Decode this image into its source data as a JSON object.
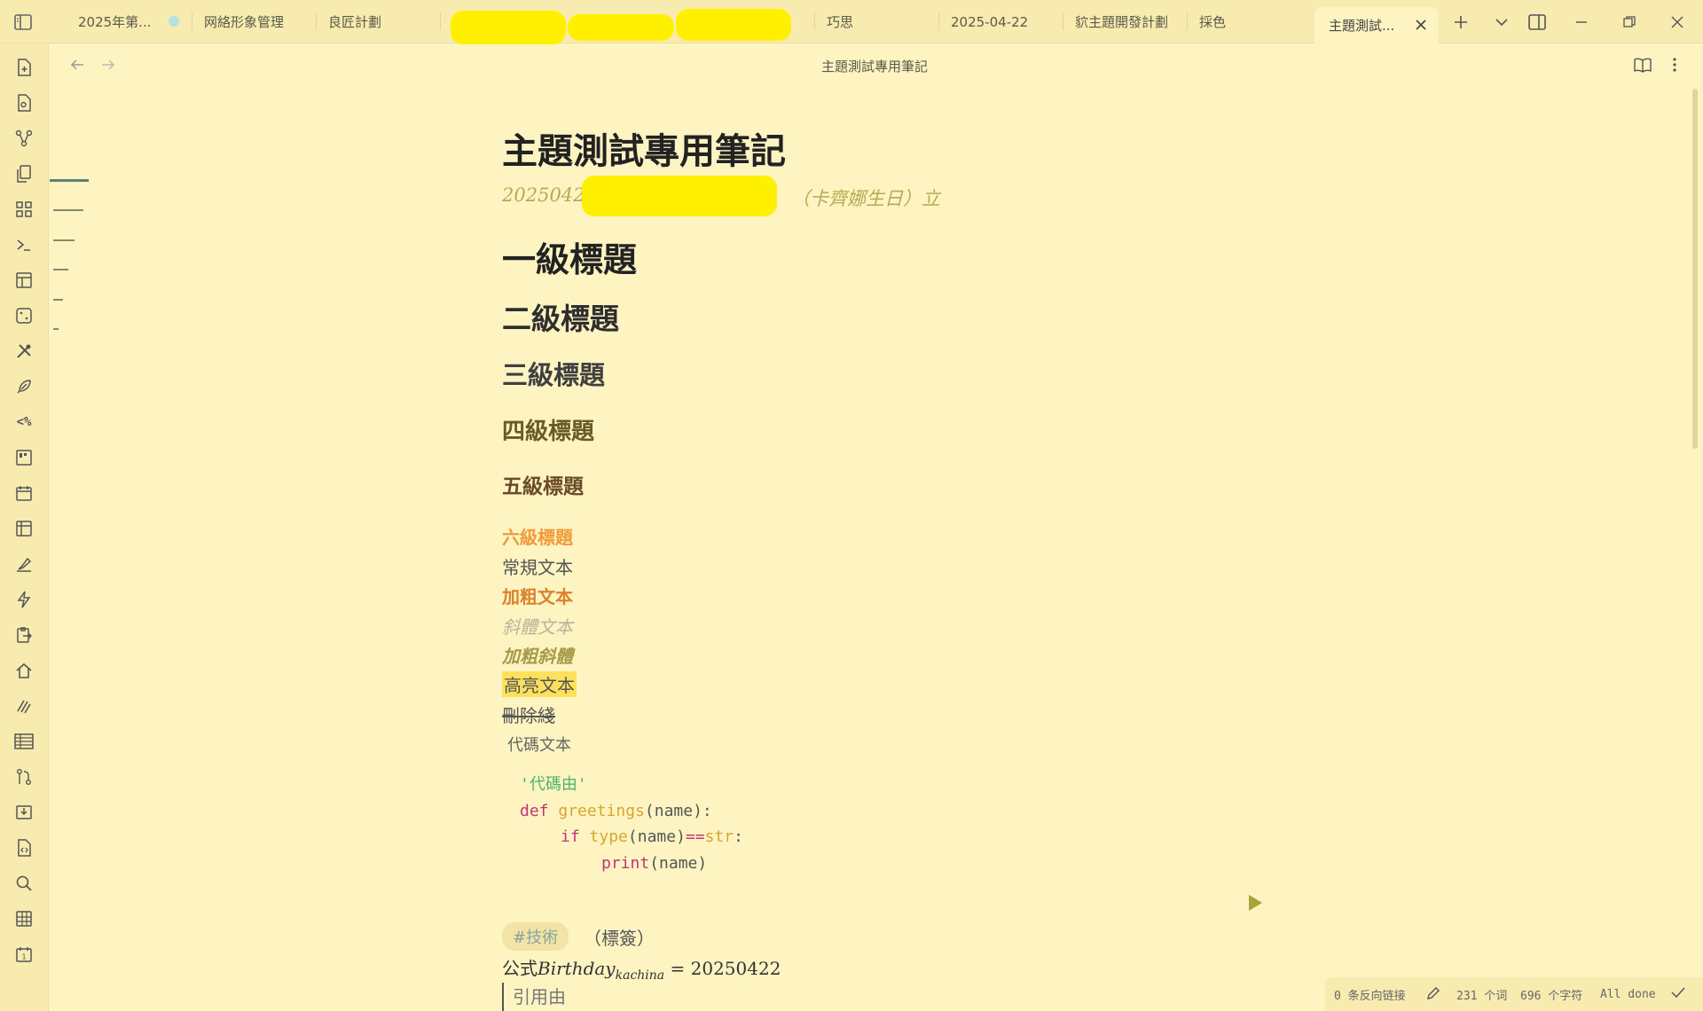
{
  "tabs": [
    {
      "label": "2025年第..."
    },
    {
      "label": "网絡形象管理"
    },
    {
      "label": "良匠計劃"
    },
    {
      "label": "巧思"
    },
    {
      "label": "2025-04-22"
    },
    {
      "label": "貁主題開發計劃"
    },
    {
      "label": "採色"
    },
    {
      "label": "主題測試..."
    }
  ],
  "view": {
    "title": "主題測試專用筆記"
  },
  "note": {
    "title": "主題測試專用筆記",
    "subtitle_prefix": "20250422",
    "subtitle_suffix": "（卡齊娜生日）立",
    "h1": "一級標題",
    "h2": "二級標題",
    "h3": "三級標題",
    "h4": "四級標題",
    "h5": "五級標題",
    "h6": "六級標題",
    "normal": "常規文本",
    "bold": "加粗文本",
    "italic": "斜體文本",
    "bold_italic": "加粗斜體",
    "highlight": "高亮文本",
    "strike": "刪除綫",
    "inline_code": "代碼文本",
    "code": {
      "line1": "'代碼由'",
      "kw_def": "def",
      "fn_name": "greetings",
      "params": "(name):",
      "kw_if": "if",
      "fn_type": "type",
      "paren_name": "(name)",
      "op_eq": "==",
      "cls_str": "str",
      "colon": ":",
      "fn_print": "print",
      "print_args": "(name)"
    },
    "tag": "#技術",
    "tag_note": "（標簽）",
    "formula_prefix": "公式",
    "formula_var": "Birthday",
    "formula_sub": "kachina",
    "formula_eq": "= 20250422",
    "quote": "引用由"
  },
  "status": {
    "backlinks": "0 条反向链接",
    "words": "231 个词",
    "chars": "696 个字符",
    "sync": "All done"
  },
  "colors": {
    "background": "#fdf4c2",
    "accent": "#b8a954",
    "highlight": "#fce15c",
    "h6": "#f09a3a",
    "bold": "#d9822b",
    "keyword": "#c2347a",
    "function": "#d6a730",
    "string": "#52b36a"
  }
}
